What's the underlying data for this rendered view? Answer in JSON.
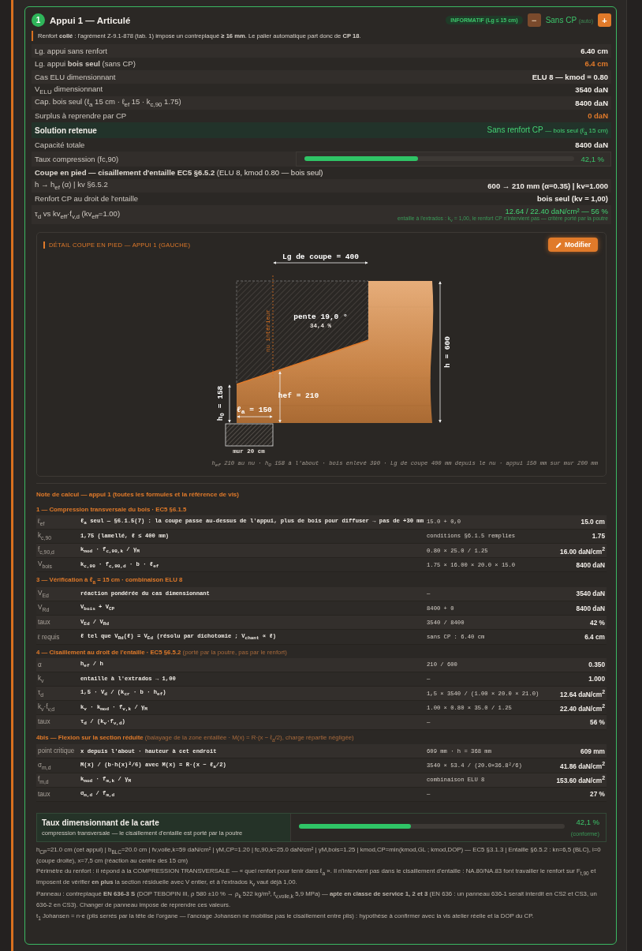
{
  "card": {
    "number": "1",
    "title": "Appui 1 — Articulé",
    "tag": "INFORMATIF (Lg ≤ 15 cm)",
    "decrease_button": "−",
    "reinforcement": "Sans CP",
    "reinforcement_mode": "(auto)",
    "increase_button": "+",
    "notice": "Renfort **collé** : l'agrément Z-9.1-878 (tab. 1) impose un contreplaqué **≥ 16 mm**. Le palier automatique part donc de **CP 18**."
  },
  "summary": {
    "rows": [
      {
        "kind": "plain",
        "label": "Lg. appui sans renfort",
        "value": "6.40 cm"
      },
      {
        "kind": "warning",
        "label": "Lg. appui **bois seul** (sans CP)",
        "value": "6.4 cm"
      },
      {
        "kind": "plain",
        "label": "Cas ELU dimensionnant",
        "value": "ELU 8 — kmod = 0.80"
      },
      {
        "kind": "plain",
        "label": "V$_{ELU}$ dimensionnant",
        "value": "3540 daN"
      },
      {
        "kind": "plain",
        "label": "Cap. bois seul (ℓ$_{a}$ 15 cm · ℓ$_{ef}$ 15 · k$_{c,90}$ 1.75)",
        "value": "8400 daN"
      },
      {
        "kind": "warning",
        "label": "Surplus à reprendre par CP",
        "value": "0 daN"
      },
      {
        "kind": "solution",
        "label": "Solution retenue",
        "value": "Sans renfort CP",
        "detail": "— bois seul (ℓ$_{a}$ 15 cm)"
      },
      {
        "kind": "plain",
        "label": "Capacité totale",
        "value": "8400 daN"
      },
      {
        "kind": "gauge",
        "label": "Taux compression (fc,90)",
        "level": 0.421,
        "reading": "42,1 %"
      },
      {
        "kind": "heading",
        "label": "**Coupe en pied — cisaillement d'entaille EC5 §6.5.2** (ELU 8, kmod 0.80 — bois seul)"
      },
      {
        "kind": "plain",
        "label": "h → h$_{ef}$ (α) | kv §6.5.2",
        "value": "600 → 210 mm (α=0.35) | kv=1.000"
      },
      {
        "kind": "plain",
        "label": "Renfort CP au droit de l'entaille",
        "value": "bois seul (kv = 1,00)"
      },
      {
        "kind": "result",
        "label": "τ$_{d}$ vs kv$_{eff}$·f$_{v,d}$ (kv$_{eff}$=1.00)",
        "value": "12.64 / 22.40 daN/cm² — 56 %",
        "note": "entaille à l'extrados : k$_{v}$ = 1,00, le renfort CP n'intervient pas — critère porté par la poutre"
      }
    ]
  },
  "detail": {
    "title": "DÉTAIL COUPE EN PIED — APPUI 1 (GAUCHE)",
    "edit_button": "Modifier",
    "drawing": {
      "cut_length": "Lg de coupe = 400",
      "slope": "pente 19,0 °",
      "slope_percent": "34,4 %",
      "inner_face": "nu intérieur",
      "height": "h = 600",
      "effective_height": "hef = 210",
      "end_height": "h$_{0}$ = 158",
      "bearing_length": "ℓ$_{a}$ = 150",
      "wall": "mur 20 cm"
    },
    "caption": "h$_{ef}$ 210 au nu · h$_{0}$ 158 à l'about · bois enlevé 390 · Lg de coupe 400 mm depuis le nu · appui 150 mm sur mur 200 mm"
  },
  "calc_note": {
    "title": "Note de calcul — appui 1 (toutes les formules et la référence de vis)",
    "sections": [
      {
        "heading": "1 — Compression transversale du bois · EC5 §6.1.5",
        "rows": [
          {
            "symbol": "ℓ$_{ef}$",
            "formula": "ℓ$_{a}$ seul — §6.1.5(7) : la coupe passe au-dessus de l'appui, plus de bois pour diffuser → pas de +30 mm",
            "substitution": "15.0 + 0,0",
            "result": "15.0 cm"
          },
          {
            "symbol": "k$_{c,90}$",
            "formula": "1,75 (lamellé, ℓ ≤ 400 mm)",
            "substitution": "conditions §6.1.5 remplies",
            "result": "1.75"
          },
          {
            "symbol": "f$_{c,90,d}$",
            "formula": "k$_{mod}$ · f$_{c,90,k}$ / γ$_{M}$",
            "substitution": "0.80 × 25.0 / 1.25",
            "result": "16.00 daN/cm$^{2}$"
          },
          {
            "symbol": "V$_{bois}$",
            "formula": "k$_{c,90}$ · f$_{c,90,d}$ · b · ℓ$_{ef}$",
            "substitution": "1.75 × 16.00 × 20.0 × 15.0",
            "result": "8400 daN"
          }
        ]
      },
      {
        "heading": "3 — Vérification à ℓ$_{a}$ = 15 cm · combinaison ELU 8",
        "rows": [
          {
            "symbol": "V$_{Ed}$",
            "formula": "réaction pondérée du cas dimensionnant",
            "substitution": "—",
            "result": "3540 daN"
          },
          {
            "symbol": "V$_{Rd}$",
            "formula": "V$_{bois}$ + V$_{CP}$",
            "substitution": "8400 + 0",
            "result": "8400 daN"
          },
          {
            "symbol": "taux",
            "formula": "V$_{Ed}$ / V$_{Rd}$",
            "substitution": "3540 / 8400",
            "result": "42 %"
          },
          {
            "symbol": "ℓ requis",
            "formula": "ℓ tel que V$_{Rd}$(ℓ) = V$_{Ed}$ (résolu par dichotomie ; V$_{chant}$ ∝ ℓ)",
            "substitution": "sans CP : 6.40 cm",
            "result": "6.4 cm"
          }
        ]
      },
      {
        "heading": "4 — Cisaillement au droit de l'entaille · EC5 §6.5.2",
        "note": "(porté par la poutre, pas par le renfort)",
        "rows": [
          {
            "symbol": "α",
            "formula": "h$_{ef}$ / h",
            "substitution": "210 / 600",
            "result": "0.350"
          },
          {
            "symbol": "k$_{v}$",
            "formula": "entaille à l'extrados → 1,00",
            "substitution": "—",
            "result": "1.000"
          },
          {
            "symbol": "τ$_{d}$",
            "formula": "1,5 · V$_{d}$ / (k$_{cr}$ · b · h$_{ef}$)",
            "substitution": "1,5 × 3540 / (1.00 × 20.0 × 21.0)",
            "result": "12.64 daN/cm$^{2}$"
          },
          {
            "symbol": "k$_{v}$·f$_{v,d}$",
            "formula": "k$_{v}$ · k$_{mod}$ · f$_{v,k}$ / γ$_{M}$",
            "substitution": "1.00 × 0.80 × 35.0 / 1.25",
            "result": "22.40 daN/cm$^{2}$"
          },
          {
            "symbol": "taux",
            "formula": "τ$_{d}$ / (k$_{v}$·f$_{v,d}$)",
            "substitution": "—",
            "result": "56 %"
          }
        ]
      },
      {
        "heading": "4bis — Flexion sur la section réduite",
        "note": "(balayage de la zone entaillée · M(x) = R·(x − ℓ$_{a}$/2), charge répartie négligée)",
        "rows": [
          {
            "symbol": "point critique",
            "formula": "x depuis l'about · hauteur à cet endroit",
            "substitution": "609 mm · h = 368 mm",
            "result": "609 mm"
          },
          {
            "symbol": "σ$_{m,d}$",
            "formula": "M(x) / (b·h(x)²/6)   avec M(x) = R·(x − ℓ$_{a}$/2)",
            "substitution": "3540 × 53.4 / (20.0×36.8²/6)",
            "result": "41.86 daN/cm$^{2}$"
          },
          {
            "symbol": "f$_{m,d}$",
            "formula": "k$_{mod}$ · f$_{m,k}$ / γ$_{M}$",
            "substitution": "combinaison ELU 8",
            "result": "153.60 daN/cm$^{2}$"
          },
          {
            "symbol": "taux",
            "formula": "σ$_{m,d}$ / f$_{m,d}$",
            "substitution": "—",
            "result": "27 %"
          }
        ]
      }
    ]
  },
  "overall": {
    "title": "Taux dimensionnant de la carte",
    "subtitle": "compression transversale — le cisaillement d'entaille est porté par la poutre",
    "level": 0.421,
    "reading": "42,1 %",
    "status": "(conforme)"
  },
  "footnotes": [
    "h$_{CP}$=21.0 cm (cet appui) | b$_{BLC}$=20.0 cm | fv,voile,k=59 daN/cm² | γM,CP=1.20 | fc,90,k=25.0 daN/cm² | γM,bois=1.25 | kmod,CP=min(kmod,GL ; kmod,DOP) — EC5 §3.1.3 | Entaille §6.5.2 : kn=6,5 (BLC), i=0 (coupe droite), x=7,5 cm (réaction au centre des 15 cm)",
    "Périmètre du renfort : il répond à la COMPRESSION TRANSVERSALE — « quel renfort pour tenir dans ℓ$_{a}$ ». Il n'intervient pas dans le cisaillement d'entaille : NA.80/NA.83 font travailler le renfort sur F$_{t,90}$ et imposent de vérifier **en plus** la section résiduelle avec V entier, et à l'extrados k$_{v}$ vaut déjà 1,00.",
    "Panneau : contreplaqué **EN 636-3 S** (DOP TEBOPIN III, ρ 580 ±10 % → ρ$_{k}$ 522 kg/m³, f$_{v,voile,k}$ 5,9 MPa) — **apte en classe de service 1, 2 et 3** (EN 636 : un panneau 636-1 serait interdit en CS2 et CS3, un 636-2 en CS3). Changer de panneau impose de reprendre ces valeurs.",
    "t$_{1}$ Johansen = n·e (plis serrés par la tête de l'organe — l'ancrage Johansen ne mobilise pas le cisaillement entre plis) : hypothèse à confirmer avec la vis atelier réelle et la DOP du CP."
  ]
}
